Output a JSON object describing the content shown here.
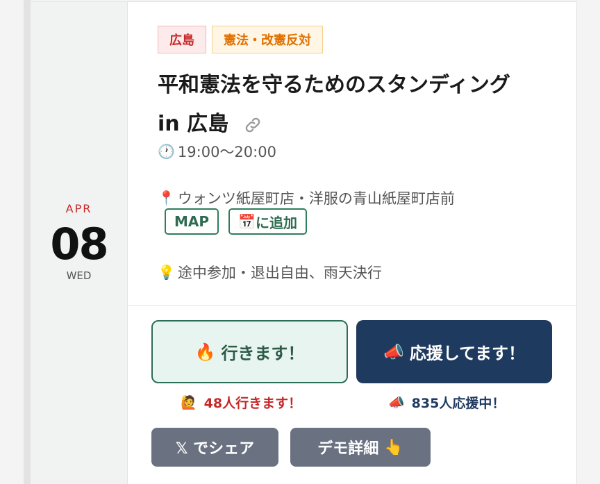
{
  "date": {
    "month": "APR",
    "day": "08",
    "weekday": "WED"
  },
  "tags": [
    {
      "label": "広島",
      "color": "#c62828"
    },
    {
      "label": "憲法・改憲反対",
      "color": "#e07000"
    }
  ],
  "event": {
    "title_line1": "平和憲法を守るためのスタンディング",
    "title_line2": "in 広島",
    "time_icon": "🕐",
    "time": "19:00〜20:00",
    "place_icon": "📍",
    "place": "ウォンツ紙屋町店・洋服の青山紙屋町店前",
    "note_icon": "💡",
    "note": "途中参加・退出自由、雨天決行"
  },
  "buttons": {
    "map": "MAP",
    "calendar_icon": "📅",
    "calendar": "に追加",
    "go_icon": "🔥",
    "go": "行きます！",
    "support_icon": "📣",
    "support": "応援してます！",
    "share": "𝕏 でシェア",
    "detail": "デモ詳細",
    "detail_icon": "👆"
  },
  "counts": {
    "go_icon": "🙋",
    "go": "48人行きます！",
    "support_icon": "📣",
    "support": "835人応援中！"
  },
  "colors": {
    "accent": "#2e7d5b",
    "navy": "#1f3a5f",
    "red": "#c62828",
    "gray_button": "#6a7282"
  }
}
